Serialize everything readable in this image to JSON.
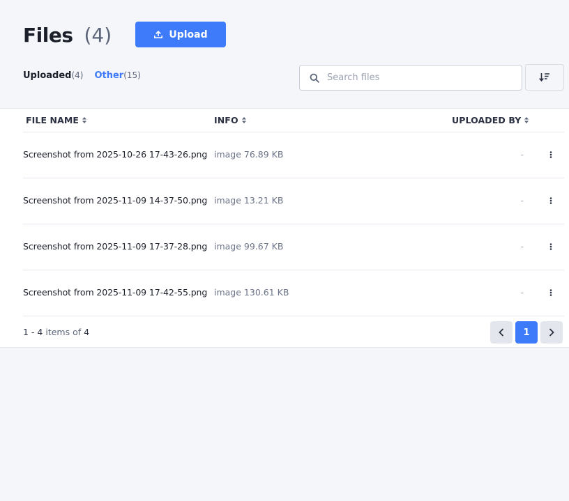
{
  "header": {
    "title": "Files",
    "count": "(4)",
    "upload_label": "Upload"
  },
  "tabs": [
    {
      "label": "Uploaded",
      "count": "(4)"
    },
    {
      "label": "Other",
      "count": "(15)"
    }
  ],
  "search": {
    "placeholder": "Search files",
    "value": ""
  },
  "table": {
    "columns": [
      "FILE NAME",
      "INFO",
      "UPLOADED BY"
    ],
    "rows": [
      {
        "name": "Screenshot from 2025-10-26 17-43-26.png",
        "info": "image 76.89 KB",
        "uploaded_by": "-"
      },
      {
        "name": "Screenshot from 2025-11-09 14-37-50.png",
        "info": "image 13.21 KB",
        "uploaded_by": "-"
      },
      {
        "name": "Screenshot from 2025-11-09 17-37-28.png",
        "info": "image 99.67 KB",
        "uploaded_by": "-"
      },
      {
        "name": "Screenshot from 2025-11-09 17-42-55.png",
        "info": "image 130.61 KB",
        "uploaded_by": "-"
      }
    ]
  },
  "pagination": {
    "range": "1 - 4",
    "items_of": "items of",
    "total": "4",
    "current_page": "1"
  },
  "colors": {
    "accent": "#3e7bfa",
    "background": "#f5f6fa",
    "text": "#1b1f2a"
  },
  "icons": {
    "upload": "upload-icon",
    "search": "search-icon",
    "sort": "sort-icon",
    "column_sort": "sort-arrows-icon",
    "row_menu": "kebab-icon",
    "prev": "chevron-left-icon",
    "next": "chevron-right-icon"
  }
}
